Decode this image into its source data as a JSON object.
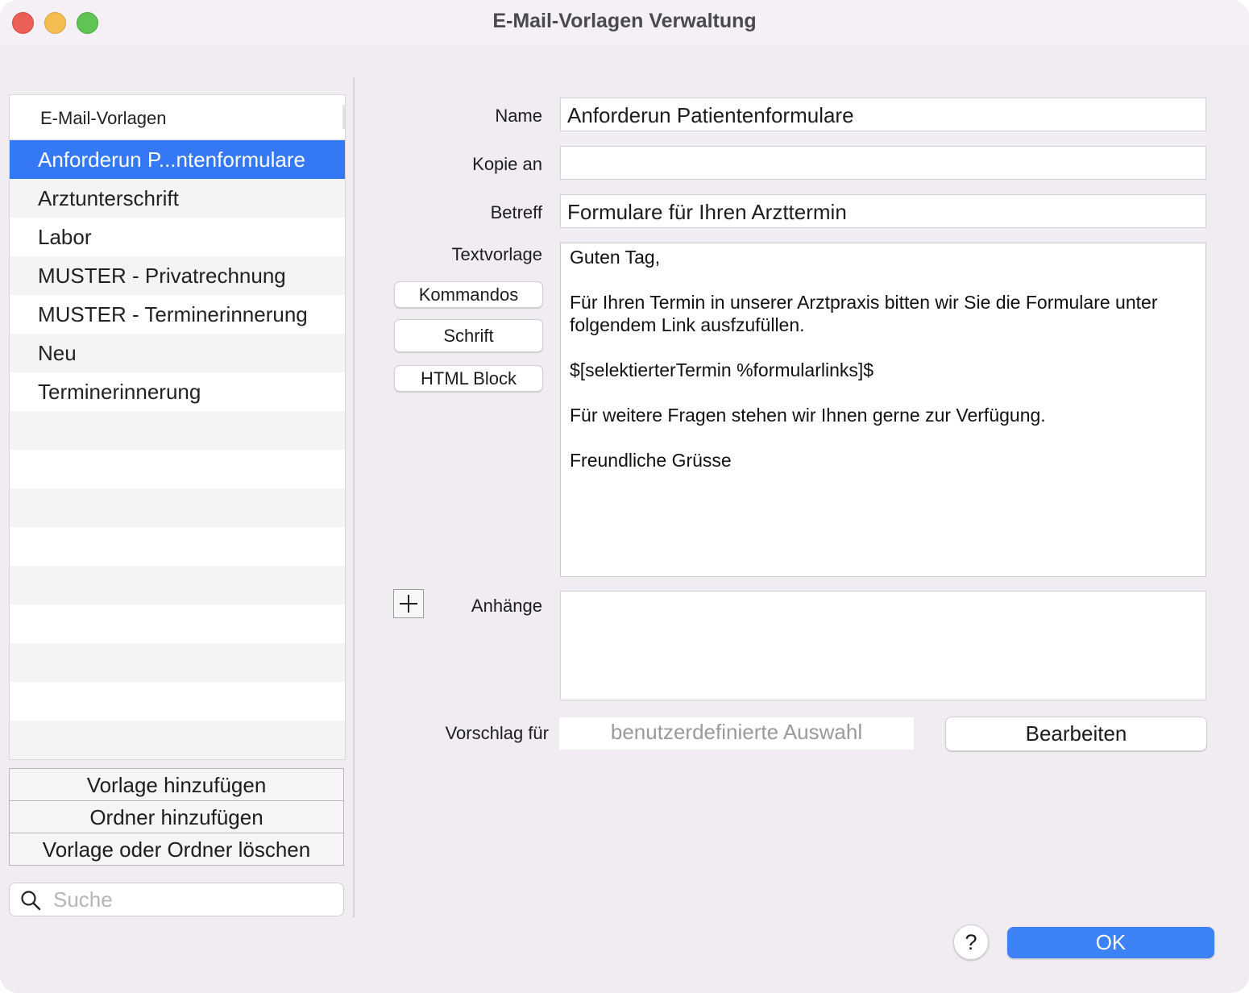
{
  "window": {
    "title": "E-Mail-Vorlagen Verwaltung"
  },
  "sidebar": {
    "header": "E-Mail-Vorlagen",
    "items": [
      {
        "label": "Anforderun P...ntenformulare",
        "selected": true
      },
      {
        "label": "Arztunterschrift"
      },
      {
        "label": "Labor"
      },
      {
        "label": "MUSTER - Privatrechnung"
      },
      {
        "label": "MUSTER - Terminerinnerung"
      },
      {
        "label": "Neu"
      },
      {
        "label": "Terminerinnerung"
      }
    ],
    "buttons": {
      "add_template": "Vorlage hinzufügen",
      "add_folder": "Ordner hinzufügen",
      "delete": "Vorlage oder Ordner löschen"
    },
    "search": {
      "placeholder": "Suche",
      "value": ""
    }
  },
  "form": {
    "name_label": "Name",
    "name_value": "Anforderun Patientenformulare",
    "cc_label": "Kopie an",
    "cc_value": "",
    "subject_label": "Betreff",
    "subject_value": "Formulare für Ihren Arzttermin",
    "body_label": "Textvorlage",
    "body_lines": [
      "Guten Tag,",
      "",
      "Für Ihren Termin in unserer Arztpraxis bitten wir Sie die Formulare unter",
      "folgendem Link ausfzufüllen.",
      "",
      "$[selektierterTermin %formularlinks]$",
      "",
      "Für weitere Fragen stehen wir Ihnen gerne zur Verfügung.",
      "",
      "Freundliche Grüsse"
    ],
    "commands_button": "Kommandos",
    "font_button": "Schrift",
    "html_block_button": "HTML Block",
    "attachments_label": "Anhänge",
    "suggest_label": "Vorschlag für",
    "suggest_value": "benutzerdefinierte Auswahl",
    "edit_button": "Bearbeiten"
  },
  "footer": {
    "help": "?",
    "ok": "OK"
  },
  "colors": {
    "accent": "#3478f6",
    "ok_button": "#3e82f7",
    "window_bg": "#f0ecf2"
  }
}
